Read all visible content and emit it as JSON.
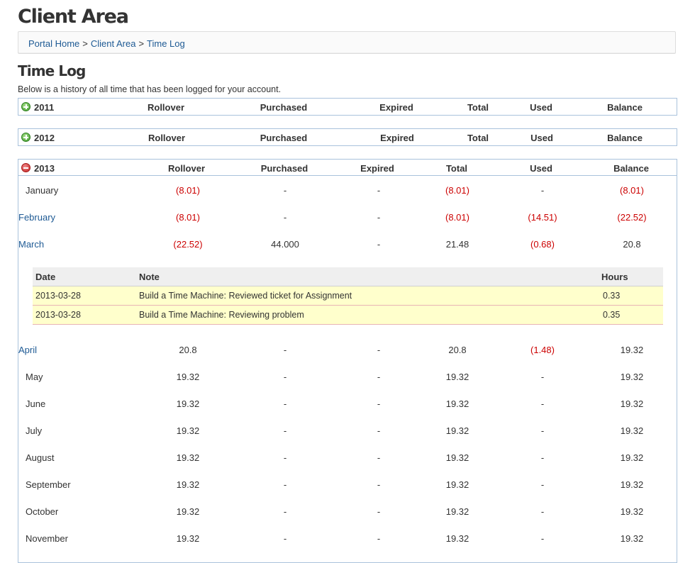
{
  "page_title": "Client Area",
  "breadcrumb": [
    {
      "label": "Portal Home"
    },
    {
      "label": "Client Area"
    },
    {
      "label": "Time Log"
    }
  ],
  "breadcrumb_separator": ">",
  "section_title": "Time Log",
  "intro": "Below is a history of all time that has been logged for your account.",
  "columns": {
    "rollover": "Rollover",
    "purchased": "Purchased",
    "expired": "Expired",
    "total": "Total",
    "used": "Used",
    "balance": "Balance"
  },
  "years": [
    {
      "year": "2011",
      "expanded": false,
      "icon": "expand-plus-icon"
    },
    {
      "year": "2012",
      "expanded": false,
      "icon": "expand-plus-icon"
    },
    {
      "year": "2013",
      "expanded": true,
      "icon": "collapse-minus-icon"
    }
  ],
  "months_2013": [
    {
      "name": "January",
      "link": false,
      "rollover": "(8.01)",
      "purchased": "-",
      "expired": "-",
      "total": "(8.01)",
      "used": "-",
      "balance": "(8.01)"
    },
    {
      "name": "February",
      "link": true,
      "rollover": "(8.01)",
      "purchased": "-",
      "expired": "-",
      "total": "(8.01)",
      "used": "(14.51)",
      "balance": "(22.52)"
    },
    {
      "name": "March",
      "link": true,
      "rollover": "(22.52)",
      "purchased": "44.000",
      "expired": "-",
      "total": "21.48",
      "used": "(0.68)",
      "balance": "20.8"
    },
    {
      "name": "April",
      "link": true,
      "rollover": "20.8",
      "purchased": "-",
      "expired": "-",
      "total": "20.8",
      "used": "(1.48)",
      "balance": "19.32"
    },
    {
      "name": "May",
      "link": false,
      "rollover": "19.32",
      "purchased": "-",
      "expired": "-",
      "total": "19.32",
      "used": "-",
      "balance": "19.32"
    },
    {
      "name": "June",
      "link": false,
      "rollover": "19.32",
      "purchased": "-",
      "expired": "-",
      "total": "19.32",
      "used": "-",
      "balance": "19.32"
    },
    {
      "name": "July",
      "link": false,
      "rollover": "19.32",
      "purchased": "-",
      "expired": "-",
      "total": "19.32",
      "used": "-",
      "balance": "19.32"
    },
    {
      "name": "August",
      "link": false,
      "rollover": "19.32",
      "purchased": "-",
      "expired": "-",
      "total": "19.32",
      "used": "-",
      "balance": "19.32"
    },
    {
      "name": "September",
      "link": false,
      "rollover": "19.32",
      "purchased": "-",
      "expired": "-",
      "total": "19.32",
      "used": "-",
      "balance": "19.32"
    },
    {
      "name": "October",
      "link": false,
      "rollover": "19.32",
      "purchased": "-",
      "expired": "-",
      "total": "19.32",
      "used": "-",
      "balance": "19.32"
    },
    {
      "name": "November",
      "link": false,
      "rollover": "19.32",
      "purchased": "-",
      "expired": "-",
      "total": "19.32",
      "used": "-",
      "balance": "19.32"
    }
  ],
  "march_details": {
    "headers": {
      "date": "Date",
      "note": "Note",
      "hours": "Hours"
    },
    "rows": [
      {
        "date": "2013-03-28",
        "note": "Build a Time Machine: Reviewed ticket for Assignment",
        "hours": "0.33"
      },
      {
        "date": "2013-03-28",
        "note": "Build a Time Machine: Reviewing problem",
        "hours": "0.35"
      }
    ]
  },
  "colors": {
    "link": "#1e5a94",
    "negative": "#cc0000",
    "box_border": "#a9c2dc",
    "detail_row_bg": "#ffffcc"
  }
}
